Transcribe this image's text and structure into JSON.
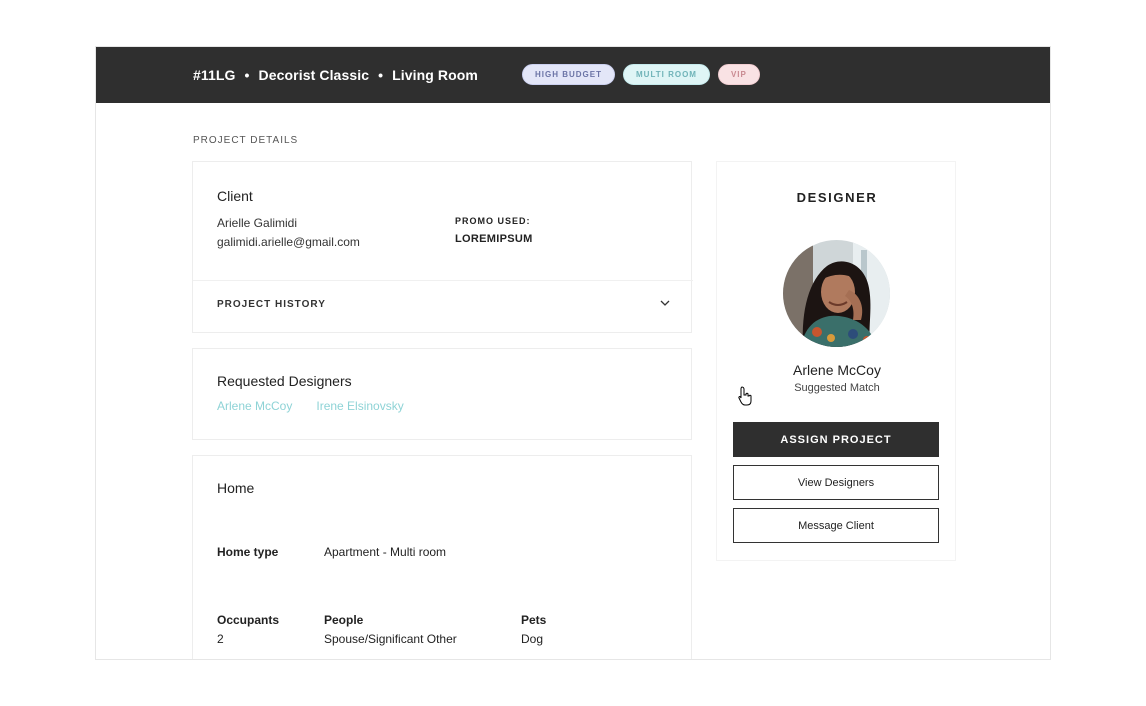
{
  "header": {
    "project_id": "#11LG",
    "package": "Decorist Classic",
    "room": "Living Room",
    "separator": "•",
    "tags": [
      "HIGH BUDGET",
      "MULTI ROOM",
      "VIP"
    ]
  },
  "section_title": "PROJECT DETAILS",
  "client": {
    "heading": "Client",
    "name": "Arielle Galimidi",
    "email": "galimidi.arielle@gmail.com",
    "promo_label": "PROMO USED:",
    "promo_value": "LOREMIPSUM",
    "history_label": "PROJECT HISTORY"
  },
  "requested": {
    "heading": "Requested Designers",
    "designers": [
      "Arlene McCoy",
      "Irene Elsinovsky"
    ]
  },
  "home": {
    "heading": "Home",
    "home_type_label": "Home type",
    "home_type_value": "Apartment - Multi room",
    "occupants_label": "Occupants",
    "occupants_value": "2",
    "people_label": "People",
    "people_value": "Spouse/Significant Other",
    "pets_label": "Pets",
    "pets_value": "Dog"
  },
  "designer": {
    "heading": "DESIGNER",
    "name": "Arlene McCoy",
    "subtitle": "Suggested Match",
    "assign_label": "ASSIGN PROJECT",
    "view_label": "View Designers",
    "message_label": "Message Client"
  },
  "colors": {
    "header_bg": "#2f2f2f",
    "link": "#8ed3d6",
    "tag_budget": "#e3e6f8",
    "tag_multi": "#dff5f6",
    "tag_vip": "#f9e2e4"
  },
  "icons": {
    "history_toggle": "chevron-down-icon",
    "pointer": "cursor-icon"
  }
}
